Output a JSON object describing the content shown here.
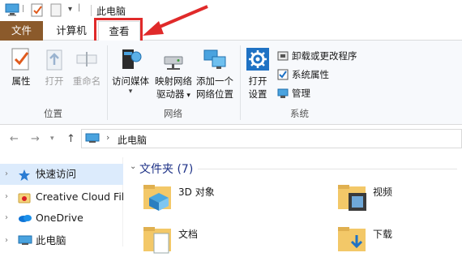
{
  "window": {
    "title": "此电脑"
  },
  "ribbon_tabs": {
    "file": "文件",
    "computer": "计算机",
    "view": "查看"
  },
  "ribbon": {
    "location_group": {
      "label": "位置",
      "buttons": {
        "properties": "属性",
        "open": "打开",
        "rename": "重命名"
      }
    },
    "network_group": {
      "label": "网络",
      "buttons": {
        "media": "访问媒体",
        "map_drive_line1": "映射网络",
        "map_drive_line2": "驱动器",
        "add_location_line1": "添加一个",
        "add_location_line2": "网络位置"
      }
    },
    "system_group": {
      "label": "系统",
      "open_settings_line1": "打开",
      "open_settings_line2": "设置",
      "items": {
        "uninstall": "卸载或更改程序",
        "system_props": "系统属性",
        "manage": "管理"
      }
    }
  },
  "address": {
    "path": "此电脑"
  },
  "nav_pane": {
    "items": [
      {
        "label": "快速访问"
      },
      {
        "label": "Creative Cloud Files"
      },
      {
        "label": "OneDrive"
      },
      {
        "label": "此电脑"
      }
    ]
  },
  "content": {
    "section_header": "文件夹 (7)",
    "folders": [
      {
        "label": "3D 对象"
      },
      {
        "label": "视频"
      },
      {
        "label": "文档"
      },
      {
        "label": "下载"
      }
    ]
  },
  "colors": {
    "file_tab": "#8b5a2b",
    "highlight": "#e02a2a",
    "selection": "#dcebfc",
    "section_header": "#1e3287"
  }
}
